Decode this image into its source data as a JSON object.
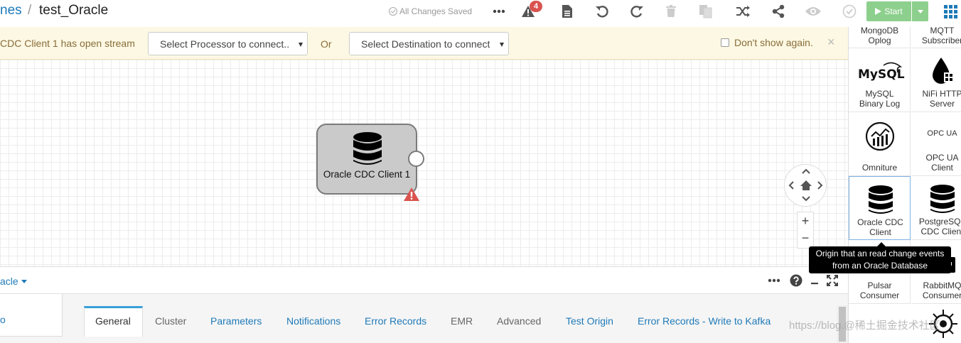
{
  "header": {
    "breadcrumb_parent": "nes",
    "breadcrumb_separator": "/",
    "pipeline_title": "test_Oracle",
    "saved_status": "All Changes Saved",
    "alert_count": "4",
    "start_label": "Start"
  },
  "warning_bar": {
    "message": "CDC Client 1 has open stream",
    "processor_select": "Select Processor to connect...",
    "or_label": "Or",
    "destination_select": "Select Destination to connect...",
    "dont_show_label": "Don't show again.",
    "close_glyph": "×"
  },
  "canvas": {
    "stage_label": "Oracle CDC Client 1",
    "zoom_in": "+",
    "zoom_out": "−"
  },
  "library": {
    "items": [
      {
        "label": "MongoDB\nOplog"
      },
      {
        "label": "MQTT\nSubscriber"
      },
      {
        "label": "MySQL\nBinary Log",
        "logo_text": "MySQL"
      },
      {
        "label": "NiFi HTTP\nServer"
      },
      {
        "label": "Omniture"
      },
      {
        "label": "OPC UA\nClient",
        "logo_text": "OPC UA"
      },
      {
        "label": "Oracle CDC\nClient"
      },
      {
        "label": "PostgreSQL\nCDC Client"
      },
      {
        "label": "Pulsar\nConsumer"
      },
      {
        "label": "RabbitMQ\nConsumer"
      }
    ],
    "tooltip_line1": "Origin that an read change events",
    "tooltip_line2": "from an Oracle Database"
  },
  "bottom": {
    "pipeline_menu": "acle",
    "side_label": "o",
    "tabs": [
      {
        "label": "General"
      },
      {
        "label": "Cluster"
      },
      {
        "label": "Parameters"
      },
      {
        "label": "Notifications"
      },
      {
        "label": "Error Records"
      },
      {
        "label": "EMR"
      },
      {
        "label": "Advanced"
      },
      {
        "label": "Test Origin"
      },
      {
        "label": "Error Records - Write to Kafka"
      }
    ]
  },
  "watermark": "https://blog.@稀土掘金技术社区",
  "colors": {
    "accent": "#1f7ab8",
    "warning_bg": "#fcf8e3",
    "start_button": "#8dcf8d",
    "alert_badge": "#d9534f",
    "stage_fill": "#cacaca"
  }
}
